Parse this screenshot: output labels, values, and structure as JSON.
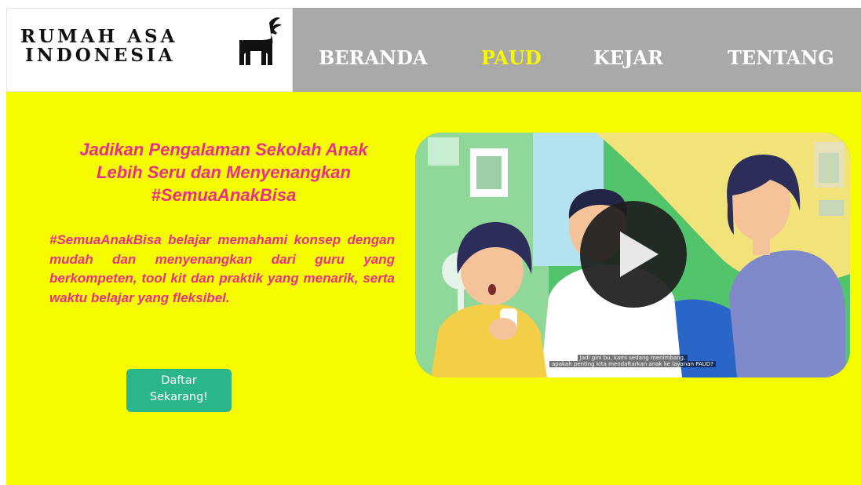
{
  "brand": {
    "line1": "RUMAH ASA",
    "line2": "INDONESIA",
    "logo_icon": "antelope-icon"
  },
  "nav": {
    "items": [
      {
        "label": "BERANDA",
        "active": false
      },
      {
        "label": "PAUD",
        "active": true
      },
      {
        "label": "KEJAR",
        "active": false
      },
      {
        "label": "TENTANG",
        "active": false
      }
    ]
  },
  "hero": {
    "headline_line1": "Jadikan Pengalaman Sekolah Anak",
    "headline_line2": "Lebih Seru dan Menyenangkan",
    "headline_line3": "#SemuaAnakBisa",
    "body": "#SemuaAnakBisa belajar memahami konsep dengan mudah dan menyenangkan dari guru yang berkompeten, tool kit dan praktik yang menarik, serta waktu belajar yang fleksibel.",
    "cta_line1": "Daftar",
    "cta_line2": "Sekarang!"
  },
  "video": {
    "play_icon": "play-icon",
    "caption_line1": "Jadi gini bu, kami sedang menimbang,",
    "caption_line2": "apakah penting kita mendaftarkan anak ke layanan PAUD?"
  },
  "colors": {
    "accent_yellow": "#f7fb00",
    "nav_gray": "#a9a9a9",
    "text_pink": "#e8308a",
    "button_green": "#2bb58a",
    "active_nav": "#f7f700"
  }
}
